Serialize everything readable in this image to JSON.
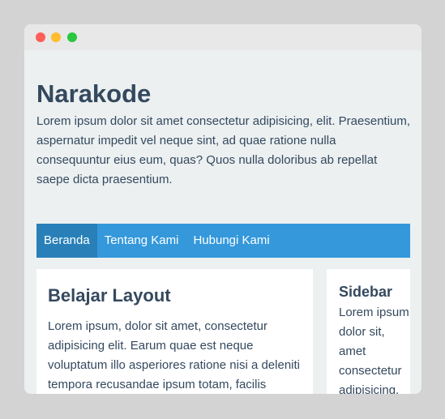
{
  "window": {
    "controls": [
      "close",
      "minimize",
      "maximize"
    ]
  },
  "header": {
    "title": "Narakode",
    "description": "Lorem ipsum dolor sit amet consectetur adipisicing, elit. Praesentium, aspernatur impedit vel neque sint, ad quae ratione nulla consequuntur eius eum, quas? Quos nulla doloribus ab repellat saepe dicta praesentium."
  },
  "nav": {
    "items": [
      {
        "label": "Beranda",
        "active": true
      },
      {
        "label": "Tentang Kami",
        "active": false
      },
      {
        "label": "Hubungi Kami",
        "active": false
      }
    ]
  },
  "main": {
    "title": "Belajar Layout",
    "body": "Lorem ipsum, dolor sit amet, consectetur adipisicing elit. Earum quae est neque voluptatum illo asperiores ratione nisi a deleniti tempora recusandae ipsum totam, facilis numquam similique aliquam sed ut,"
  },
  "sidebar": {
    "title": "Sidebar",
    "body": "Lorem ipsum dolor sit, amet consectetur adipisicing,"
  },
  "colors": {
    "page_bg": "#d3d3d3",
    "window_bg": "#ecf0f1",
    "nav_bg": "#3498db",
    "nav_active_bg": "#2980b9",
    "text": "#34495e"
  }
}
